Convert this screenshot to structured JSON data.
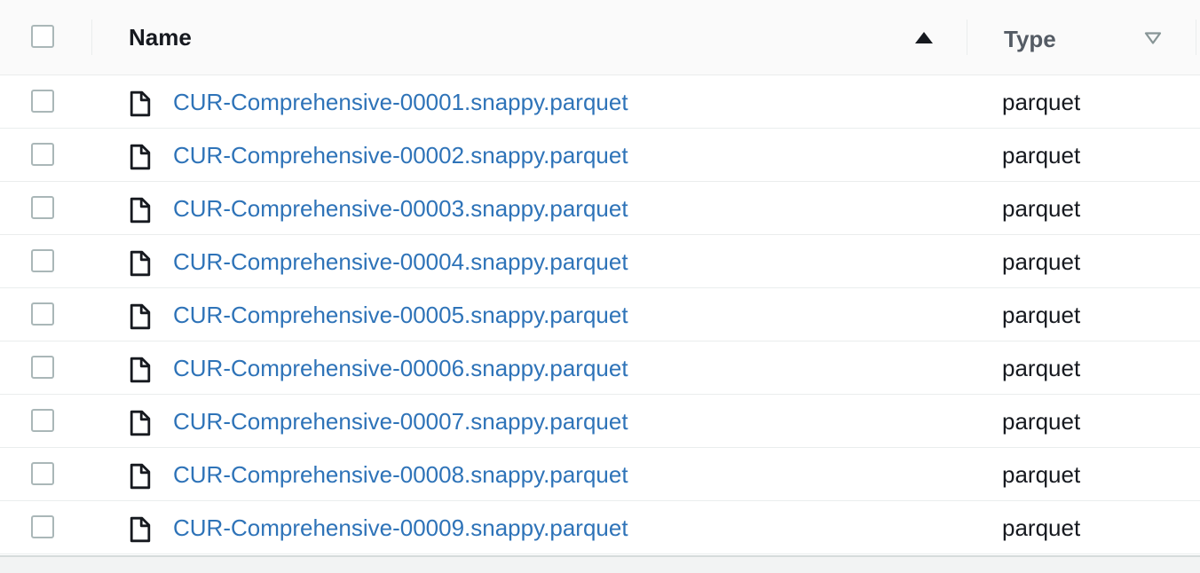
{
  "table": {
    "columns": [
      {
        "label": "Name",
        "sort": "ascending"
      },
      {
        "label": "Type",
        "sort": "none"
      }
    ],
    "rows": [
      {
        "name": "CUR-Comprehensive-00001.snappy.parquet",
        "type": "parquet",
        "icon": "file-icon"
      },
      {
        "name": "CUR-Comprehensive-00002.snappy.parquet",
        "type": "parquet",
        "icon": "file-icon"
      },
      {
        "name": "CUR-Comprehensive-00003.snappy.parquet",
        "type": "parquet",
        "icon": "file-icon"
      },
      {
        "name": "CUR-Comprehensive-00004.snappy.parquet",
        "type": "parquet",
        "icon": "file-icon"
      },
      {
        "name": "CUR-Comprehensive-00005.snappy.parquet",
        "type": "parquet",
        "icon": "file-icon"
      },
      {
        "name": "CUR-Comprehensive-00006.snappy.parquet",
        "type": "parquet",
        "icon": "file-icon"
      },
      {
        "name": "CUR-Comprehensive-00007.snappy.parquet",
        "type": "parquet",
        "icon": "file-icon"
      },
      {
        "name": "CUR-Comprehensive-00008.snappy.parquet",
        "type": "parquet",
        "icon": "file-icon"
      },
      {
        "name": "CUR-Comprehensive-00009.snappy.parquet",
        "type": "parquet",
        "icon": "file-icon"
      }
    ]
  },
  "colors": {
    "link": "#2e73b8",
    "text": "#16191f",
    "border": "#eaeded",
    "checkbox_border": "#aab7b8"
  }
}
